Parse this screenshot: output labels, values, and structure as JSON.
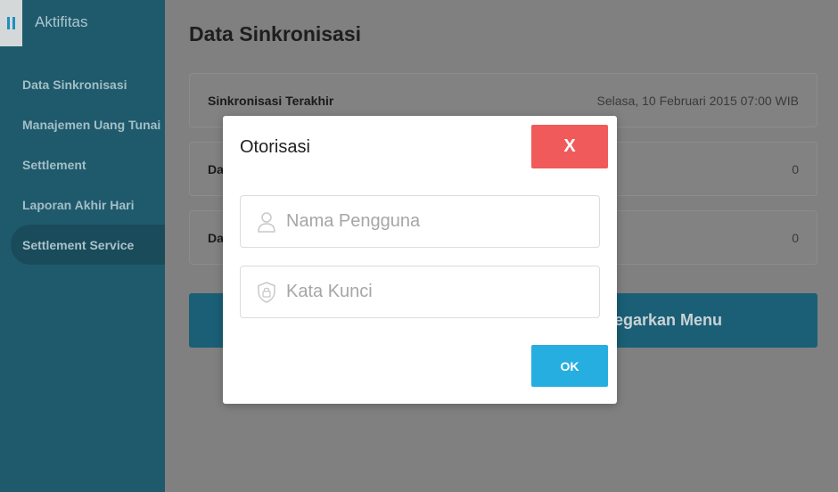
{
  "sidebar": {
    "title": "Aktifitas",
    "items": [
      {
        "label": "Data Sinkronisasi"
      },
      {
        "label": "Manajemen Uang Tunai"
      },
      {
        "label": "Settlement"
      },
      {
        "label": "Laporan Akhir Hari"
      },
      {
        "label": "Settlement Service",
        "active": true
      }
    ]
  },
  "main": {
    "title": "Data Sinkronisasi",
    "rows": [
      {
        "label": "Sinkronisasi Terakhir",
        "value": "Selasa, 10 Februari 2015 07:00 WIB"
      },
      {
        "label": "Da",
        "value": "0"
      },
      {
        "label": "Da",
        "value": "0"
      }
    ],
    "button_label": "egarkan Menu"
  },
  "modal": {
    "title": "Otorisasi",
    "close_label": "X",
    "username_placeholder": "Nama Pengguna",
    "password_placeholder": "Kata Kunci",
    "ok_label": "OK"
  },
  "colors": {
    "sidebar_bg": "#1f5a6c",
    "close_button": "#f05a5b",
    "ok_button": "#27aee0"
  },
  "icons": [
    "menu-icon",
    "user-icon",
    "shield-lock-icon"
  ]
}
